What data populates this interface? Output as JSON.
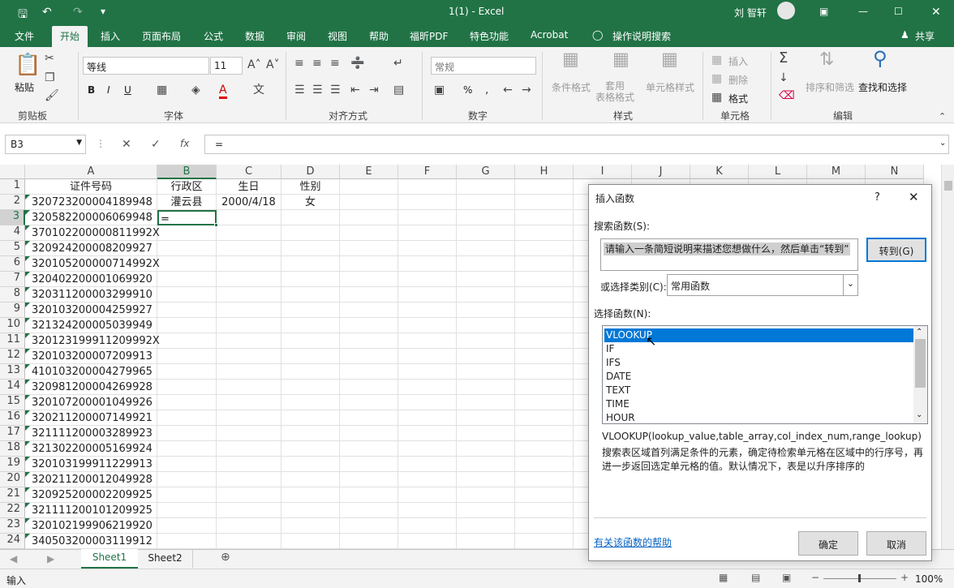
{
  "titlebar": {
    "doc_title": "1(1)  -  Excel",
    "user": "刘 智轩"
  },
  "tabs": [
    "文件",
    "开始",
    "插入",
    "页面布局",
    "公式",
    "数据",
    "审阅",
    "视图",
    "帮助",
    "福昕PDF",
    "特色功能",
    "Acrobat"
  ],
  "tell_me": "操作说明搜索",
  "share": "共享",
  "ribbon": {
    "clipboard": {
      "paste": "粘贴",
      "group": "剪贴板"
    },
    "font": {
      "name": "等线",
      "size": "11",
      "group": "字体",
      "bold": "B",
      "italic": "I",
      "underline": "U"
    },
    "alignment": {
      "group": "对齐方式"
    },
    "number": {
      "format": "常规",
      "group": "数字",
      "percent": "%"
    },
    "styles": {
      "cond": "条件格式",
      "table": "套用\n表格格式",
      "cell": "单元格样式",
      "group": "样式"
    },
    "cells": {
      "insert": "插入",
      "delete": "删除",
      "format": "格式",
      "group": "单元格"
    },
    "editing": {
      "sort": "排序和筛选",
      "find": "查找和选择",
      "group": "编辑"
    }
  },
  "formula_bar": {
    "name_box": "B3",
    "fx": "fx",
    "content": "="
  },
  "columns": [
    "A",
    "B",
    "C",
    "D",
    "E",
    "F",
    "G",
    "H",
    "I",
    "J",
    "K",
    "L",
    "M",
    "N"
  ],
  "rows": [
    {
      "n": "1",
      "a": "证件号码",
      "b": "行政区",
      "c": "生日",
      "d": "性别"
    },
    {
      "n": "2",
      "a": "320723200004189948",
      "b": "灌云县",
      "c": "2000/4/18",
      "d": "女"
    },
    {
      "n": "3",
      "a": "320582200006069948",
      "b": "=",
      "c": "",
      "d": ""
    },
    {
      "n": "4",
      "a": "370102200000811992X",
      "b": "",
      "c": "",
      "d": ""
    },
    {
      "n": "5",
      "a": "320924200008209927",
      "b": "",
      "c": "",
      "d": ""
    },
    {
      "n": "6",
      "a": "320105200000714992X",
      "b": "",
      "c": "",
      "d": ""
    },
    {
      "n": "7",
      "a": "320402200001069920",
      "b": "",
      "c": "",
      "d": ""
    },
    {
      "n": "8",
      "a": "320311200003299910",
      "b": "",
      "c": "",
      "d": ""
    },
    {
      "n": "9",
      "a": "320103200004259927",
      "b": "",
      "c": "",
      "d": ""
    },
    {
      "n": "10",
      "a": "321324200005039949",
      "b": "",
      "c": "",
      "d": ""
    },
    {
      "n": "11",
      "a": "320123199911209992X",
      "b": "",
      "c": "",
      "d": ""
    },
    {
      "n": "12",
      "a": "320103200007209913",
      "b": "",
      "c": "",
      "d": ""
    },
    {
      "n": "13",
      "a": "410103200004279965",
      "b": "",
      "c": "",
      "d": ""
    },
    {
      "n": "14",
      "a": "320981200004269928",
      "b": "",
      "c": "",
      "d": ""
    },
    {
      "n": "15",
      "a": "320107200001049926",
      "b": "",
      "c": "",
      "d": ""
    },
    {
      "n": "16",
      "a": "320211200007149921",
      "b": "",
      "c": "",
      "d": ""
    },
    {
      "n": "17",
      "a": "321111200003289923",
      "b": "",
      "c": "",
      "d": ""
    },
    {
      "n": "18",
      "a": "321302200005169924",
      "b": "",
      "c": "",
      "d": ""
    },
    {
      "n": "19",
      "a": "320103199911229913",
      "b": "",
      "c": "",
      "d": ""
    },
    {
      "n": "20",
      "a": "320211200012049928",
      "b": "",
      "c": "",
      "d": ""
    },
    {
      "n": "21",
      "a": "320925200002209925",
      "b": "",
      "c": "",
      "d": ""
    },
    {
      "n": "22",
      "a": "321111200101209925",
      "b": "",
      "c": "",
      "d": ""
    },
    {
      "n": "23",
      "a": "320102199906219920",
      "b": "",
      "c": "",
      "d": ""
    },
    {
      "n": "24",
      "a": "340503200003119912",
      "b": "",
      "c": "",
      "d": ""
    }
  ],
  "sheets": [
    "Sheet1",
    "Sheet2"
  ],
  "status": {
    "mode": "输入",
    "zoom": "100%"
  },
  "dialog": {
    "title": "插入函数",
    "help": "?",
    "search_label": "搜索函数(S):",
    "search_text": "请输入一条简短说明来描述您想做什么，然后单击“转到”",
    "go": "转到(G)",
    "category_label": "或选择类别(C):",
    "category": "常用函数",
    "select_label": "选择函数(N):",
    "functions": [
      "VLOOKUP",
      "IF",
      "IFS",
      "DATE",
      "TEXT",
      "TIME",
      "HOUR"
    ],
    "signature": "VLOOKUP(lookup_value,table_array,col_index_num,range_lookup)",
    "description": "搜索表区域首列满足条件的元素，确定待检索单元格在区域中的行序号，再进一步返回选定单元格的值。默认情况下，表是以升序排序的",
    "help_link": "有关该函数的帮助",
    "ok": "确定",
    "cancel": "取消"
  }
}
